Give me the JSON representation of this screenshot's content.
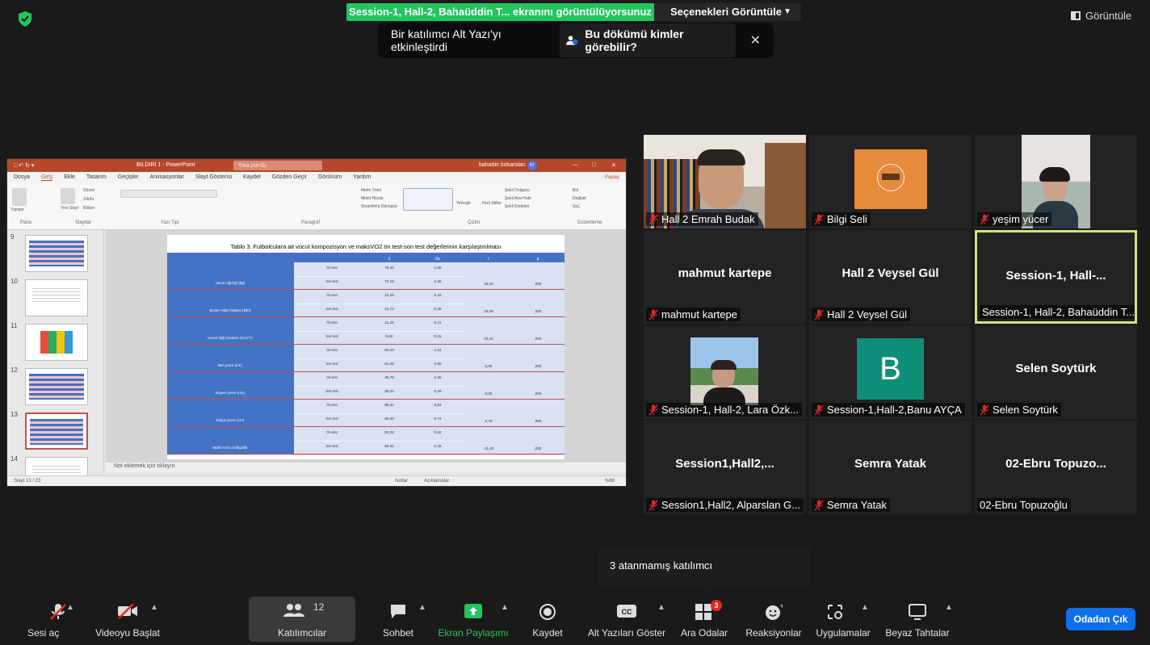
{
  "top": {
    "share_banner": "Session-1, Hall-2, Bahaüddin T... ekranını görüntülüyorsunuz",
    "view_options": "Seçenekleri Görüntüle",
    "view_button": "Görüntüle",
    "caption_notice": "Bir katılımcı Alt Yazı'yı etkinleştirdi",
    "caption_who": "Bu dökümü kimler görebilir?"
  },
  "ppt": {
    "file_title": "BILDIRI 1 - PowerPoint",
    "search": "Ara (Alt+Ö)",
    "user": "bahattin türkarslan",
    "user_initials": "BT",
    "share": "Paylaş",
    "menu": [
      "Dosya",
      "Giriş",
      "Ekle",
      "Tasarım",
      "Geçişler",
      "Animasyonlar",
      "Slayt Gösterisi",
      "Kaydet",
      "Gözden Geçir",
      "Görünüm",
      "Yardım"
    ],
    "groups": [
      "Pano",
      "Slaytlar",
      "Yazı Tipi",
      "Paragraf",
      "Çizim",
      "Düzenleme"
    ],
    "ribbon_items": [
      "Yapıştır",
      "Yeni Slayt",
      "Düzen",
      "Sıfırla",
      "Bölüm",
      "Metin Yönü",
      "Metni Hizala",
      "SmartArt'a Dönüştür",
      "Yerleştir",
      "Hızlı Stiller",
      "Şekil Dolgusu",
      "Şekil Ana Hattı",
      "Şekil Efektleri",
      "Bul",
      "Değiştir",
      "Seç"
    ],
    "slide_numbers": [
      "9",
      "10",
      "11",
      "12",
      "13",
      "14"
    ],
    "slide_title": "Tablo 3. Futbolculara ait vücut kompozisyon ve maksVO2 ön test-son test değerlerinin karşılaştırılması",
    "table_headers": [
      "",
      "",
      "x̄",
      "Ss",
      "t",
      "p"
    ],
    "table_rows": [
      {
        "name": "Vücut Ağırlığı (kg)",
        "pre": "76,40",
        "post": "73,19",
        "ss1": "1,69",
        "ss2": "1,56",
        "t": "19,20",
        "p": ",000"
      },
      {
        "name": "Beden Kitle İndeksi (BKİ)",
        "pre": "23,28",
        "post": "21,73",
        "ss1": "0,43",
        "ss2": "0,38",
        "t": "18,09",
        "p": ",000"
      },
      {
        "name": "Vücut Yağ Yüzdesi (%VYY)",
        "pre": "11,25",
        "post": "8,82",
        "ss1": "0,41",
        "ss2": "0,31",
        "t": "10,41",
        "p": ",000"
      },
      {
        "name": "Bel çevre (cm)",
        "pre": "84,23",
        "post": "81,06",
        "ss1": "1,04",
        "ss2": "0,90",
        "t": "5,08",
        "p": ",000"
      },
      {
        "name": "Boyun çevre (cm)",
        "pre": "39,76",
        "post": "38,04",
        "ss1": "0,35",
        "ss2": "0,29",
        "t": "6,00",
        "p": ",000"
      },
      {
        "name": "Kalça çevre (cm)",
        "pre": "99,42",
        "post": "95,00",
        "ss1": "0,83",
        "ss2": "0,74",
        "t": "6,78",
        "p": ",000"
      },
      {
        "name": "Maks VO2 (ml/kg/dk)",
        "pre": "52,06",
        "post": "55,62",
        "ss1": "0,62",
        "ss2": "0,49",
        "t": "-11,93",
        "p": ",000"
      }
    ],
    "pre_label": "Ön test",
    "post_label": "Son test",
    "notes": "Not eklemek için tıklayın",
    "status_slide": "Slayt 13 / 23",
    "status_notes": "Notlar",
    "status_comments": "Açıklamalar",
    "zoom": "%68"
  },
  "gallery": [
    {
      "label": "Hall 2 Emrah Budak",
      "muted": true,
      "type": "video-man"
    },
    {
      "label": "Bilgi Seli",
      "muted": true,
      "type": "logo"
    },
    {
      "label": "yeşim yücer",
      "muted": true,
      "type": "video-woman"
    },
    {
      "label": "mahmut kartepe",
      "center": "mahmut kartepe",
      "muted": true,
      "type": "name"
    },
    {
      "label": "Hall 2 Veysel Gül",
      "center": "Hall 2 Veysel Gül",
      "muted": true,
      "type": "name"
    },
    {
      "label": "Session-1, Hall-2, Bahaüddin T...",
      "center": "Session-1,  Hall-...",
      "muted": false,
      "type": "name",
      "active": true
    },
    {
      "label": "Session-1, Hall-2, Lara Özk...",
      "muted": true,
      "type": "photo"
    },
    {
      "label": "Session-1,Hall-2,Banu AYÇA",
      "muted": true,
      "type": "avatar",
      "avatar": "B"
    },
    {
      "label": "Selen Soytürk",
      "center": "Selen Soytürk",
      "muted": true,
      "type": "name"
    },
    {
      "label": "Session1,Hall2, Alparslan G...",
      "center": "Session1,Hall2,...",
      "muted": true,
      "type": "name"
    },
    {
      "label": "Semra Yatak",
      "center": "Semra Yatak",
      "muted": true,
      "type": "name"
    },
    {
      "label": "02-Ebru Topuzoğlu",
      "center": "02-Ebru  Topuzo...",
      "muted": false,
      "type": "name"
    }
  ],
  "tooltip": "3 atanmamış katılımcı",
  "toolbar": {
    "audio": "Sesi aç",
    "video": "Videoyu Başlat",
    "participants": "Katılımcılar",
    "participants_count": "12",
    "chat": "Sohbet",
    "share": "Ekran Paylaşımı",
    "record": "Kaydet",
    "captions": "Alt Yazıları Göster",
    "breakout": "Ara Odalar",
    "breakout_badge": "3",
    "reactions": "Reaksiyonlar",
    "apps": "Uygulamalar",
    "whiteboard": "Beyaz Tahtalar",
    "leave": "Odadan Çık"
  },
  "colors": {
    "share_green": "#23c55e",
    "active_border": "#cfe57a",
    "leave_blue": "#0e71eb",
    "ppt_red": "#b7472a",
    "table_blue": "#4472c4",
    "table_light": "#d9e1f2"
  }
}
